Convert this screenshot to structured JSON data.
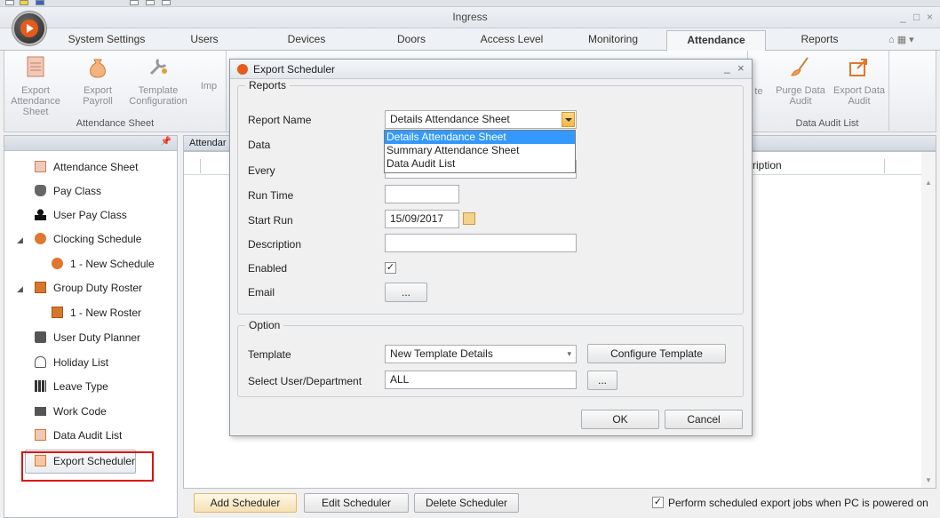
{
  "app": {
    "title": "Ingress",
    "window_controls": [
      "_",
      "□",
      "×"
    ]
  },
  "tabs": [
    {
      "label": "System Settings"
    },
    {
      "label": "Users"
    },
    {
      "label": "Devices"
    },
    {
      "label": "Doors"
    },
    {
      "label": "Access Level"
    },
    {
      "label": "Monitoring"
    },
    {
      "label": "Attendance",
      "active": true
    },
    {
      "label": "Reports"
    }
  ],
  "ribbon": {
    "attendance_sheet_group": {
      "label": "Attendance Sheet",
      "buttons": [
        {
          "label": "Export Attendance Sheet"
        },
        {
          "label": "Export Payroll"
        },
        {
          "label": "Template Configuration"
        },
        {
          "label": "Imp"
        }
      ]
    },
    "data_audit_group": {
      "label": "Data Audit List",
      "partial_left": "te",
      "buttons": [
        {
          "label": "Purge Data Audit"
        },
        {
          "label": "Export Data Audit"
        }
      ]
    }
  },
  "nav": {
    "pin": "📌",
    "items": [
      {
        "label": "Attendance Sheet",
        "icon": "sheet-icon"
      },
      {
        "label": "Pay Class",
        "icon": "money-bag-icon"
      },
      {
        "label": "User Pay Class",
        "icon": "user-icon"
      },
      {
        "label": "Clocking Schedule",
        "icon": "clock-icon",
        "expanded": true
      },
      {
        "label": "1 - New Schedule",
        "icon": "clock-icon",
        "child": true
      },
      {
        "label": "Group Duty Roster",
        "icon": "roster-icon",
        "expanded": true
      },
      {
        "label": "1 - New Roster",
        "icon": "roster-icon",
        "child": true
      },
      {
        "label": "User Duty Planner",
        "icon": "briefcase-icon"
      },
      {
        "label": "Holiday List",
        "icon": "holiday-icon"
      },
      {
        "label": "Leave Type",
        "icon": "calendar-icon"
      },
      {
        "label": "Work Code",
        "icon": "monitor-icon"
      },
      {
        "label": "Data Audit List",
        "icon": "list-icon"
      },
      {
        "label": "Export Scheduler",
        "icon": "scheduler-icon",
        "selected": true
      }
    ]
  },
  "main": {
    "header_title": "Attendar",
    "grid_column": "cription",
    "buttons": {
      "add": "Add Scheduler",
      "edit": "Edit Scheduler",
      "delete": "Delete Scheduler"
    },
    "perform_check": {
      "checked": true,
      "label": "Perform scheduled export jobs when PC is powered on"
    }
  },
  "dialog": {
    "title": "Export Scheduler",
    "controls": [
      "_",
      "×"
    ],
    "reports_group": "Reports",
    "labels": {
      "report_name": "Report Name",
      "data": "Data",
      "every": "Every",
      "run_time": "Run Time",
      "start_run": "Start Run",
      "description": "Description",
      "enabled": "Enabled",
      "email": "Email"
    },
    "report_name_value": "Details Attendance Sheet",
    "report_options": [
      "Details Attendance Sheet",
      "Summary Attendance Sheet",
      "Data Audit List"
    ],
    "run_time_value": "",
    "start_run_value": "15/09/2017",
    "description_value": "",
    "enabled": true,
    "email_button": "...",
    "option_group": "Option",
    "template_label": "Template",
    "template_value": "New Template Details",
    "configure_template": "Configure Template",
    "select_user_label": "Select User/Department",
    "select_user_value": "ALL",
    "select_user_button": "...",
    "ok": "OK",
    "cancel": "Cancel"
  }
}
